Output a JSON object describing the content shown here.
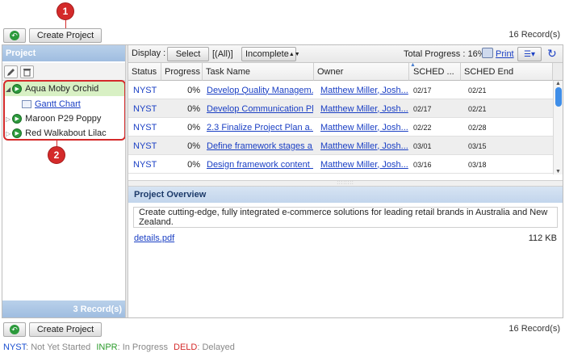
{
  "toolbar": {
    "back_label": "↶",
    "create_label": "Create Project",
    "records": "16 Record(s)"
  },
  "callouts": {
    "one": "1",
    "two": "2"
  },
  "left_panel": {
    "title": "Project",
    "tree": [
      {
        "label": "Aqua Moby Orchid",
        "expanded": true
      },
      {
        "label": "Gantt Chart"
      },
      {
        "label": "Maroon P29 Poppy"
      },
      {
        "label": "Red Walkabout Lilac"
      }
    ],
    "footer": "3 Record(s)"
  },
  "filter_bar": {
    "display_label": "Display :",
    "select_label": "Select",
    "all_label": "[(All)]",
    "status_value": "Incomplete",
    "total_progress_label": "Total Progress : 16%",
    "print_label": "Print"
  },
  "grid": {
    "columns": [
      "Status",
      "Progress",
      "Task Name",
      "Owner",
      "SCHED ...",
      "SCHED End"
    ],
    "rows": [
      {
        "status": "NYST",
        "progress": "0%",
        "task": "Develop Quality Managem...",
        "owner": "Matthew Miller, Josh...",
        "start": "02/17",
        "end": "02/21"
      },
      {
        "status": "NYST",
        "progress": "0%",
        "task": "Develop Communication Plan",
        "owner": "Matthew Miller, Josh...",
        "start": "02/17",
        "end": "02/21"
      },
      {
        "status": "NYST",
        "progress": "0%",
        "task": "2.3 Finalize Project Plan a...",
        "owner": "Matthew Miller, Josh...",
        "start": "02/22",
        "end": "02/28"
      },
      {
        "status": "NYST",
        "progress": "0%",
        "task": "Define framework stages a...",
        "owner": "Matthew Miller, Josh...",
        "start": "03/01",
        "end": "03/15"
      },
      {
        "status": "NYST",
        "progress": "0%",
        "task": "Design framework content ...",
        "owner": "Matthew Miller, Josh...",
        "start": "03/16",
        "end": "03/18"
      }
    ]
  },
  "overview": {
    "title": "Project Overview",
    "description": "Create cutting-edge, fully integrated e-commerce solutions for leading retail brands in Australia and New Zealand.",
    "file_name": "details.pdf",
    "file_size": "112 KB"
  },
  "bottom_toolbar": {
    "back_label": "↶",
    "create_label": "Create Project",
    "records": "16 Record(s)"
  },
  "legend": [
    {
      "code": "NYST",
      "text": ": Not Yet Started",
      "color": "#1a4fd0"
    },
    {
      "code": "INPR",
      "text": ": In Progress",
      "color": "#2a9a2a"
    },
    {
      "code": "DELD",
      "text": ": Delayed",
      "color": "#d42a2a"
    }
  ]
}
